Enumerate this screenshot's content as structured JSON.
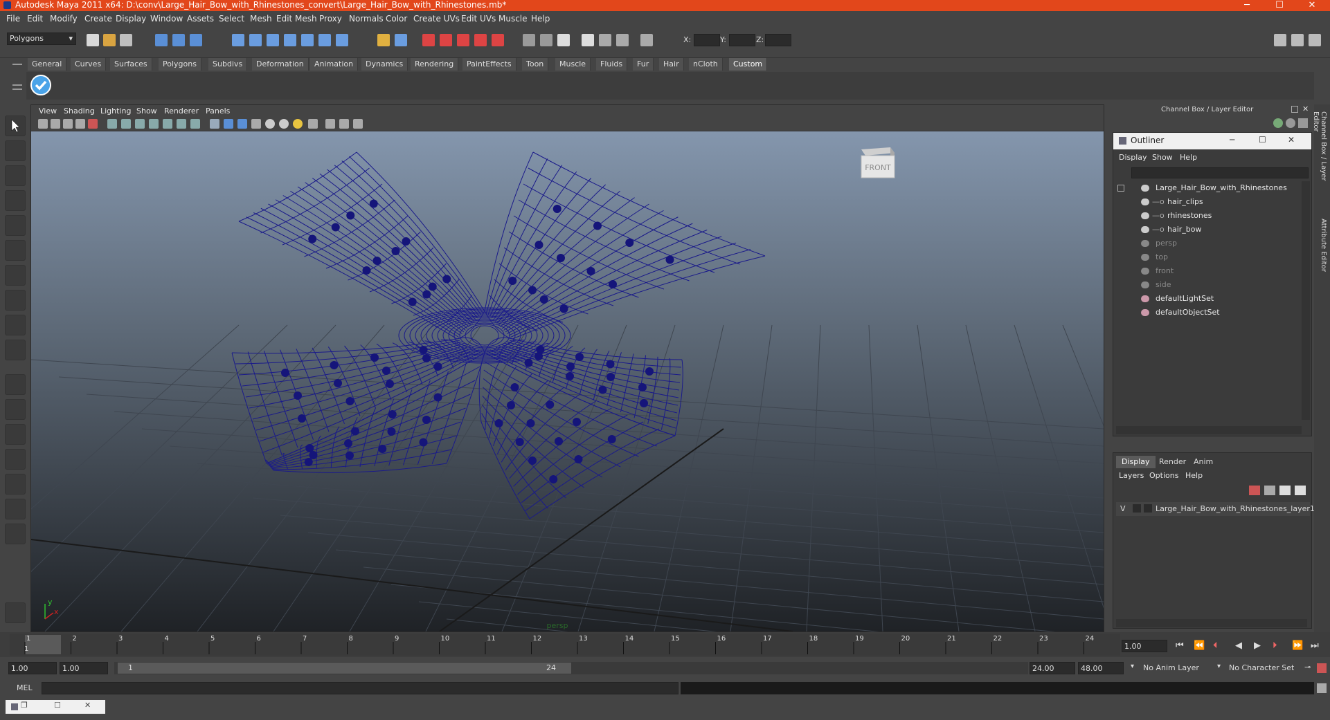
{
  "window": {
    "title": "Autodesk Maya 2011 x64: D:\\conv\\Large_Hair_Bow_with_Rhinestones_convert\\Large_Hair_Bow_with_Rhinestones.mb*",
    "minimize": "─",
    "maximize": "☐",
    "close": "✕"
  },
  "menubar": [
    "File",
    "Edit",
    "Modify",
    "Create",
    "Display",
    "Window",
    "Assets",
    "Select",
    "Mesh",
    "Edit Mesh",
    "Proxy",
    "Normals",
    "Color",
    "Create UVs",
    "Edit UVs",
    "Muscle",
    "Help"
  ],
  "statusline": {
    "mode": "Polygons",
    "x_label": "X:",
    "y_label": "Y:",
    "z_label": "Z:"
  },
  "shelf_tabs": [
    "General",
    "Curves",
    "Surfaces",
    "Polygons",
    "Subdivs",
    "Deformation",
    "Animation",
    "Dynamics",
    "Rendering",
    "PaintEffects",
    "Toon",
    "Muscle",
    "Fluids",
    "Fur",
    "Hair",
    "nCloth",
    "Custom"
  ],
  "shelf_active": "Custom",
  "viewport": {
    "menu": [
      "View",
      "Shading",
      "Lighting",
      "Show",
      "Renderer",
      "Panels"
    ],
    "view_cube_label": "FRONT",
    "camera_label": "persp",
    "axis_x": "x",
    "axis_y": "y"
  },
  "channel_box_title": "Channel Box / Layer Editor",
  "outliner": {
    "title": "Outliner",
    "menu": [
      "Display",
      "Show",
      "Help"
    ],
    "items": [
      {
        "label": "Large_Hair_Bow_with_Rhinestones",
        "indent": 0,
        "dim": false
      },
      {
        "label": "hair_clips",
        "indent": 1,
        "dim": false
      },
      {
        "label": "rhinestones",
        "indent": 1,
        "dim": false
      },
      {
        "label": "hair_bow",
        "indent": 1,
        "dim": false
      },
      {
        "label": "persp",
        "indent": 0,
        "dim": true
      },
      {
        "label": "top",
        "indent": 0,
        "dim": true
      },
      {
        "label": "front",
        "indent": 0,
        "dim": true
      },
      {
        "label": "side",
        "indent": 0,
        "dim": true
      },
      {
        "label": "defaultLightSet",
        "indent": 0,
        "dim": false
      },
      {
        "label": "defaultObjectSet",
        "indent": 0,
        "dim": false
      }
    ]
  },
  "layer_editor": {
    "tabs": [
      "Display",
      "Render",
      "Anim"
    ],
    "active_tab": "Display",
    "menu": [
      "Layers",
      "Options",
      "Help"
    ],
    "layer_visible": "V",
    "layer_name": "Large_Hair_Bow_with_Rhinestones_layer1"
  },
  "side_strip": [
    "Channel Box / Layer Editor",
    "Attribute Editor"
  ],
  "timeline": {
    "ticks": [
      "1",
      "2",
      "3",
      "4",
      "5",
      "6",
      "7",
      "8",
      "9",
      "10",
      "11",
      "12",
      "13",
      "14",
      "15",
      "16",
      "17",
      "18",
      "19",
      "20",
      "21",
      "22",
      "23",
      "24"
    ],
    "current_frame_label": "1",
    "current_time": "1.00"
  },
  "range": {
    "start_time": "1.00",
    "playback_start": "1.00",
    "slider_start": "1",
    "slider_end": "24",
    "playback_end": "24.00",
    "end_time": "48.00",
    "anim_layer": "No Anim Layer",
    "character_set": "No Character Set"
  },
  "cmdline": {
    "label": "MEL"
  },
  "colors": {
    "titlebar": "#e2471b",
    "wireframe": "#1a1a8a",
    "active_tab": "#5c5c5c"
  }
}
